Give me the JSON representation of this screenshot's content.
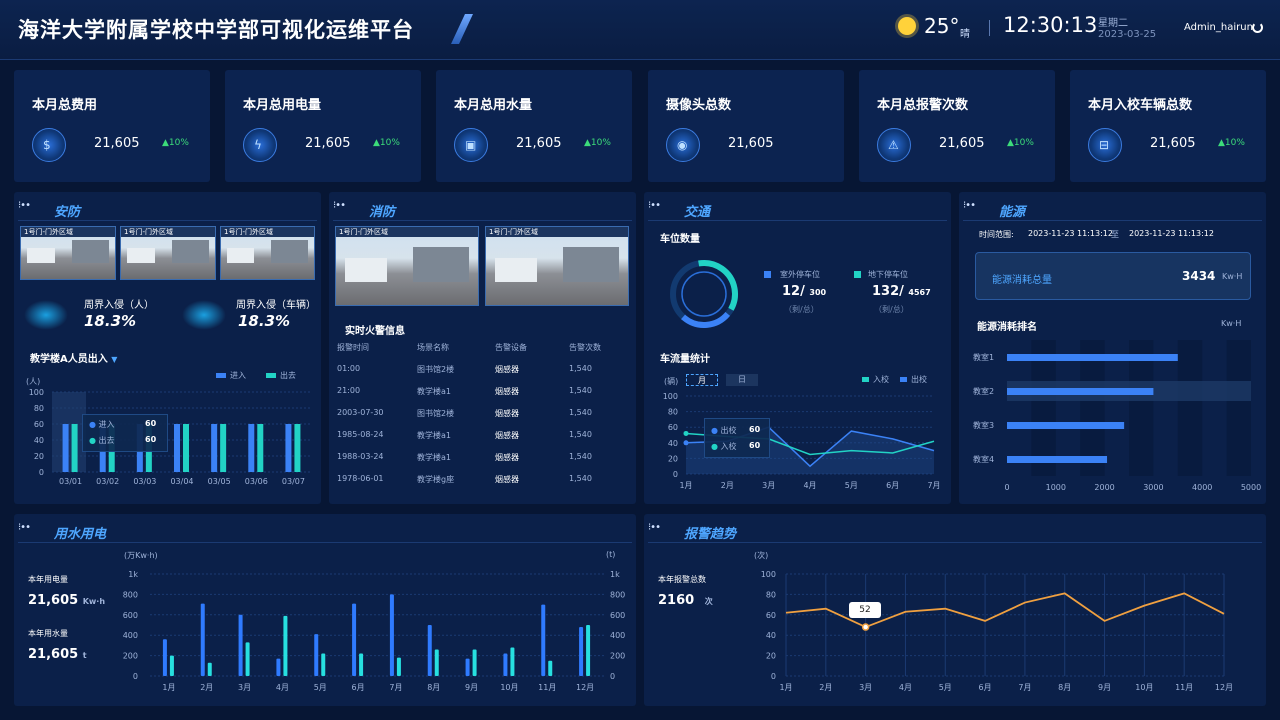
{
  "header": {
    "title": "海洋大学附属学校中学部可视化运维平台",
    "temperature": "25°",
    "weather": "晴",
    "time": "12:30:13",
    "weekday": "星期二",
    "date": "2023-03-25",
    "user": "Admin_hairun"
  },
  "stats": [
    {
      "label": "本月总费用",
      "value": "21,605",
      "change": "▲10%",
      "icon": "money-bag-icon"
    },
    {
      "label": "本月总用电量",
      "value": "21,605",
      "change": "▲10%",
      "icon": "lightning-icon"
    },
    {
      "label": "本月总用水量",
      "value": "21,605",
      "change": "▲10%",
      "icon": "water-tank-icon"
    },
    {
      "label": "摄像头总数",
      "value": "21,605",
      "change": "",
      "icon": "camera-icon"
    },
    {
      "label": "本月总报警次数",
      "value": "21,605",
      "change": "▲10%",
      "icon": "alarm-icon"
    },
    {
      "label": "本月入校车辆总数",
      "value": "21,605",
      "change": "▲10%",
      "icon": "car-icon"
    }
  ],
  "security": {
    "title": "安防",
    "cameras": [
      "1号门-门外区域",
      "1号门-门外区域",
      "1号门-门外区域"
    ],
    "intrusion_person_label": "周界入侵（人）",
    "intrusion_person_value": "18.3%",
    "intrusion_vehicle_label": "周界入侵（车辆）",
    "intrusion_vehicle_value": "18.3%",
    "selector": "教学楼A人员出入",
    "unit": "(人)",
    "legend_in": "进入",
    "legend_out": "出去",
    "tooltip_in": "60",
    "tooltip_out": "60"
  },
  "fire": {
    "title": "消防",
    "cameras": [
      "1号门-门外区域",
      "1号门-门外区域"
    ],
    "table_title": "实时火警信息",
    "headers": [
      "报警时间",
      "场景名称",
      "告警设备",
      "告警次数"
    ],
    "rows": [
      [
        "01:00",
        "图书馆2楼",
        "烟感器",
        "1,540"
      ],
      [
        "21:00",
        "教学楼a1",
        "烟感器",
        "1,540"
      ],
      [
        "2003-07-30",
        "图书馆2楼",
        "烟感器",
        "1,540"
      ],
      [
        "1985-08-24",
        "教学楼a1",
        "烟感器",
        "1,540"
      ],
      [
        "1988-03-24",
        "教学楼a1",
        "烟感器",
        "1,540"
      ],
      [
        "1978-06-01",
        "教学楼g座",
        "烟感器",
        "1,540"
      ]
    ]
  },
  "traffic": {
    "title": "交通",
    "parking_title": "车位数量",
    "outdoor_label": "室外停车位",
    "outdoor_value": "12/",
    "outdoor_total": "300",
    "indoor_label": "地下停车位",
    "indoor_value": "132/",
    "indoor_total": "4567",
    "sub": "（剩/总）",
    "flow_title": "车流量统计",
    "unit": "(辆)",
    "tab_month": "月",
    "tab_day": "日",
    "legend_in": "入校",
    "legend_out": "出校",
    "tooltip_out": "60",
    "tooltip_in": "60"
  },
  "energy": {
    "title": "能源",
    "range_label": "时间范围:",
    "range_start": "2023-11-23  11:13:12",
    "range_to": "至",
    "range_end": "2023-11-23  11:13:12",
    "total_label": "能源消耗总量",
    "total_value": "3434",
    "total_unit": "Kw·H",
    "rank_title": "能源消耗排名",
    "rank_unit": "Kw·H"
  },
  "utility": {
    "title": "用水用电",
    "unit_left": "(万Kw·h)",
    "unit_right": "(t)",
    "elec_label": "本年用电量",
    "elec_value": "21,605",
    "elec_unit": "Kw·h",
    "water_label": "本年用水量",
    "water_value": "21,605",
    "water_unit": "t"
  },
  "alarm": {
    "title": "报警趋势",
    "unit": "(次)",
    "total_label": "本年报警总数",
    "total_value": "2160",
    "total_unit": "次",
    "tooltip": "52"
  },
  "chart_data": [
    {
      "type": "bar",
      "id": "security_people",
      "categories": [
        "03/01",
        "03/02",
        "03/03",
        "03/04",
        "03/05",
        "03/06",
        "03/07"
      ],
      "series": [
        {
          "name": "进入",
          "values": [
            60,
            60,
            60,
            60,
            60,
            60,
            60
          ]
        },
        {
          "name": "出去",
          "values": [
            60,
            60,
            60,
            60,
            60,
            60,
            60
          ]
        }
      ],
      "ylim": [
        0,
        100
      ],
      "yticks": [
        0,
        20,
        40,
        60,
        80,
        100
      ],
      "ylabel": "(人)"
    },
    {
      "type": "line",
      "id": "traffic_flow",
      "categories": [
        "1月",
        "2月",
        "3月",
        "4月",
        "5月",
        "6月",
        "7月"
      ],
      "series": [
        {
          "name": "入校",
          "values": [
            52,
            48,
            45,
            25,
            30,
            27,
            42
          ]
        },
        {
          "name": "出校",
          "values": [
            40,
            42,
            60,
            10,
            55,
            45,
            30
          ]
        }
      ],
      "ylim": [
        0,
        100
      ],
      "yticks": [
        0,
        20,
        40,
        60,
        80,
        100
      ],
      "ylabel": "(辆)"
    },
    {
      "type": "bar",
      "id": "energy_rank",
      "orientation": "horizontal",
      "categories": [
        "教室1",
        "教室2",
        "教室3",
        "教室4"
      ],
      "values": [
        3500,
        3000,
        2400,
        2050
      ],
      "xlim": [
        0,
        5000
      ],
      "xticks": [
        0,
        1000,
        2000,
        3000,
        4000,
        5000
      ]
    },
    {
      "type": "bar",
      "id": "utility",
      "categories": [
        "1月",
        "2月",
        "3月",
        "4月",
        "5月",
        "6月",
        "7月",
        "8月",
        "9月",
        "10月",
        "11月",
        "12月"
      ],
      "series": [
        {
          "name": "用电",
          "values": [
            360,
            710,
            600,
            170,
            410,
            710,
            800,
            500,
            170,
            220,
            700,
            480
          ]
        },
        {
          "name": "用水",
          "values": [
            200,
            130,
            330,
            590,
            220,
            220,
            180,
            260,
            260,
            280,
            150,
            500
          ]
        }
      ],
      "ylim": [
        0,
        1000
      ],
      "yticks_left": [
        "0",
        "200",
        "400",
        "600",
        "800",
        "1k"
      ],
      "yticks_right": [
        "0",
        "200",
        "400",
        "600",
        "800",
        "1k"
      ]
    },
    {
      "type": "line",
      "id": "alarm_trend",
      "categories": [
        "1月",
        "2月",
        "3月",
        "4月",
        "5月",
        "6月",
        "7月",
        "8月",
        "9月",
        "10月",
        "11月",
        "12月"
      ],
      "values": [
        62,
        66,
        48,
        63,
        66,
        54,
        72,
        81,
        54,
        69,
        81,
        61
      ],
      "ylim": [
        0,
        100
      ],
      "yticks": [
        0,
        20,
        40,
        60,
        80,
        100
      ],
      "ylabel": "(次)"
    }
  ]
}
